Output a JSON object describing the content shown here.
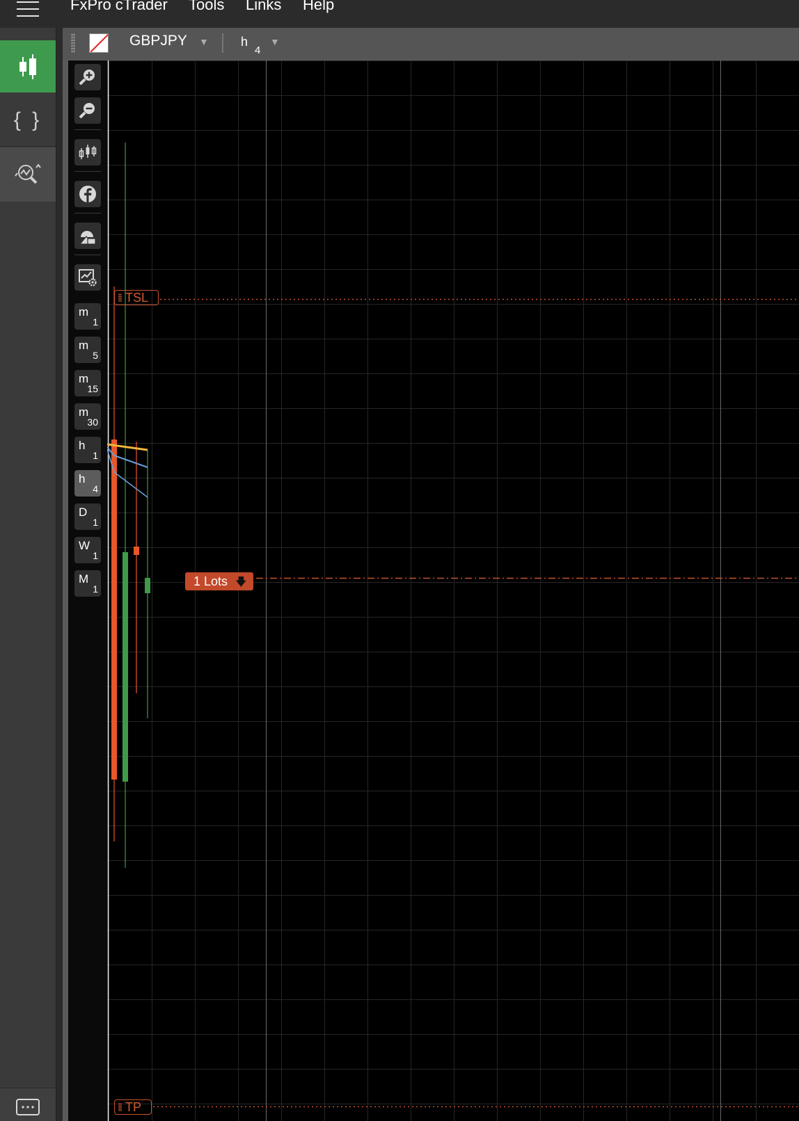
{
  "menu": {
    "items": [
      {
        "label": "FxPro cTrader"
      },
      {
        "label": "Tools"
      },
      {
        "label": "Links"
      },
      {
        "label": "Help"
      }
    ]
  },
  "leftbar": {
    "items": [
      {
        "name": "trade",
        "icon": "candlestick-icon",
        "active": true
      },
      {
        "name": "algo",
        "icon": "braces-icon",
        "label": "{ }"
      },
      {
        "name": "analyze",
        "icon": "analyze-search-icon"
      },
      {
        "name": "chat",
        "icon": "chat-icon"
      }
    ],
    "active_color": "#3e9a4d"
  },
  "toolbar": {
    "symbol": "GBPJPY",
    "timeframe_main": "h",
    "timeframe_sub": "4",
    "caret": "▼"
  },
  "tools": [
    {
      "name": "zoom-in",
      "icon": "zoom-in-icon"
    },
    {
      "name": "zoom-out",
      "icon": "zoom-out-icon"
    },
    {
      "name": "chart-type",
      "icon": "candlestick-icon"
    },
    {
      "name": "social",
      "icon": "facebook-icon"
    },
    {
      "name": "shapes",
      "icon": "shapes-icon"
    },
    {
      "name": "chart-settings",
      "icon": "chart-settings-icon"
    }
  ],
  "timeframes": [
    {
      "main": "m",
      "sub": "1"
    },
    {
      "main": "m",
      "sub": "5"
    },
    {
      "main": "m",
      "sub": "15"
    },
    {
      "main": "m",
      "sub": "30"
    },
    {
      "main": "h",
      "sub": "1"
    },
    {
      "main": "h",
      "sub": "4",
      "active": true
    },
    {
      "main": "D",
      "sub": "1"
    },
    {
      "main": "W",
      "sub": "1"
    },
    {
      "main": "M",
      "sub": "1"
    }
  ],
  "chart": {
    "tsl_label": "TSL",
    "tp_label": "TP",
    "position_label": "1 Lots",
    "position_arrow": "🡇",
    "colors": {
      "bear": "#e8572a",
      "bull": "#3f9a4a",
      "ma_yellow": "#f0b43c",
      "ma_blue": "#6a9fd8",
      "order_line": "#c8532c"
    }
  }
}
